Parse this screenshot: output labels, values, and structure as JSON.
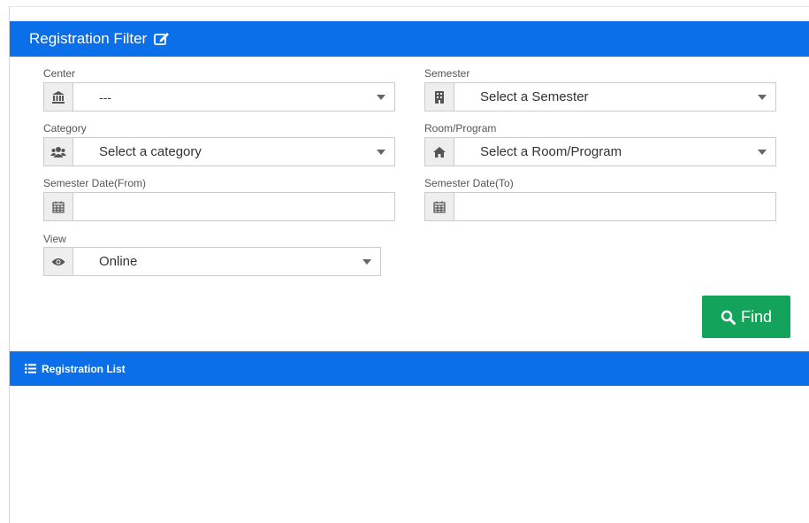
{
  "filter_panel": {
    "title": "Registration Filter",
    "fields": {
      "center": {
        "label": "Center",
        "value": "---",
        "icon": "bank-icon"
      },
      "semester": {
        "label": "Semester",
        "value": "Select a Semester",
        "icon": "building-icon"
      },
      "category": {
        "label": "Category",
        "value": "Select a category",
        "icon": "users-icon"
      },
      "room_program": {
        "label": "Room/Program",
        "value": "Select a Room/Program",
        "icon": "home-icon"
      },
      "semester_date_from": {
        "label": "Semester Date(From)",
        "value": "",
        "icon": "calendar-icon"
      },
      "semester_date_to": {
        "label": "Semester Date(To)",
        "value": "",
        "icon": "calendar-icon"
      },
      "view": {
        "label": "View",
        "value": "Online",
        "icon": "eye-icon"
      }
    },
    "find_button": "Find"
  },
  "list_panel": {
    "title": "Registration List"
  },
  "colors": {
    "header_blue": "#0a6fe8",
    "find_green": "#13a35a",
    "addon_gray": "#eeeeee"
  }
}
